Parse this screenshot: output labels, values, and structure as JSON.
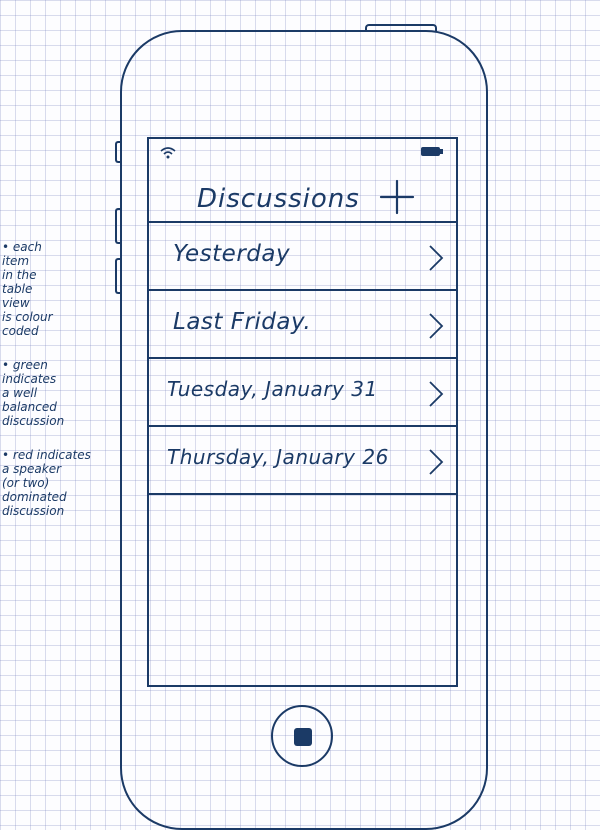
{
  "nav": {
    "title": "Discussions",
    "add_icon": "plus-icon"
  },
  "status_bar": {
    "wifi_icon": "wifi-icon",
    "battery_icon": "battery-icon"
  },
  "discussions": [
    {
      "label": "Yesterday",
      "chevron_icon": "chevron-right-icon"
    },
    {
      "label": "Last Friday.",
      "chevron_icon": "chevron-right-icon"
    },
    {
      "label": "Tuesday, January 31",
      "chevron_icon": "chevron-right-icon"
    },
    {
      "label": "Thursday, January 26",
      "chevron_icon": "chevron-right-icon"
    }
  ],
  "notes": [
    "• each\nitem\nin the\ntable\nview\nis colour\ncoded",
    "• green\nindicates\na well\nbalanced\ndiscussion",
    "• red indicates\na speaker\n(or two)\ndominated\ndiscussion"
  ],
  "colors": {
    "ink": "#1b3a66",
    "grid": "#8c96c8"
  }
}
